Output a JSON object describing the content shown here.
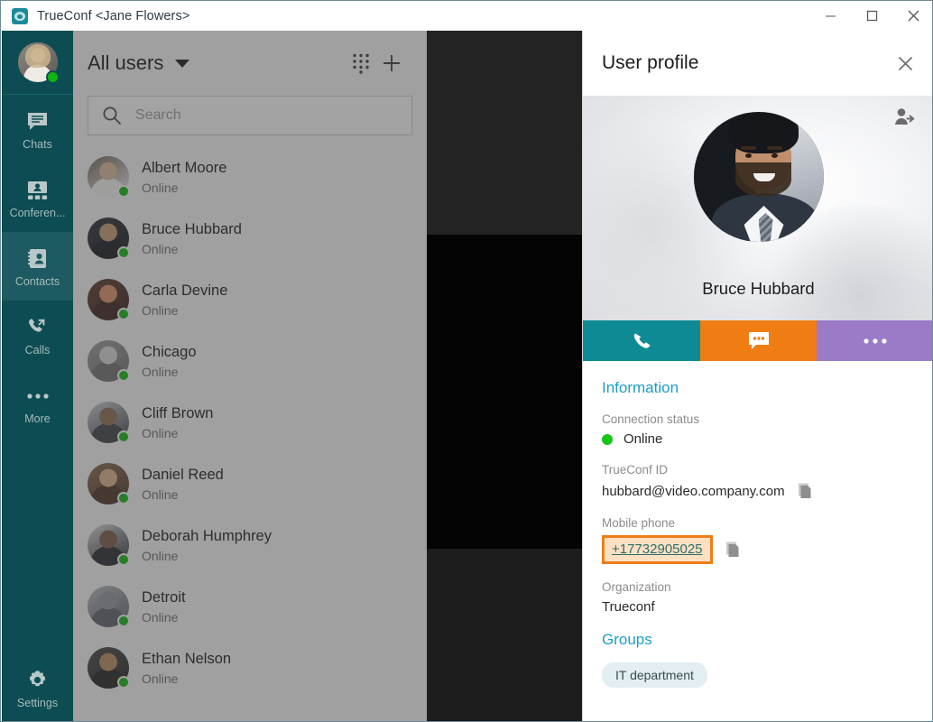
{
  "window": {
    "app_name": "TrueConf",
    "title": "TrueConf <Jane Flowers>",
    "logged_in_user": "<Jane Flowers>",
    "controls": {
      "minimize": "minimize-button",
      "maximize": "maximize-button",
      "close": "close-button"
    }
  },
  "rail": {
    "account_status": "Online",
    "items": [
      {
        "label": "Chats",
        "icon": "chat-bubble-icon",
        "active": false
      },
      {
        "label": "Conferen...",
        "icon": "conference-icon",
        "active": false
      },
      {
        "label": "Contacts",
        "icon": "address-book-icon",
        "active": true
      },
      {
        "label": "Calls",
        "icon": "call-arrows-icon",
        "active": false
      },
      {
        "label": "More",
        "icon": "ellipsis-icon",
        "active": false
      }
    ],
    "settings": {
      "label": "Settings",
      "icon": "gear-icon"
    }
  },
  "contacts": {
    "group_selector": "All users",
    "dialpad_icon": "dialpad-icon",
    "add_icon": "plus-icon",
    "search": {
      "placeholder": "Search",
      "value": "",
      "icon": "search-icon"
    },
    "list": [
      {
        "name": "Albert Moore",
        "status": "Online"
      },
      {
        "name": "Bruce Hubbard",
        "status": "Online"
      },
      {
        "name": "Carla Devine",
        "status": "Online"
      },
      {
        "name": "Chicago",
        "status": "Online"
      },
      {
        "name": "Cliff Brown",
        "status": "Online"
      },
      {
        "name": "Daniel Reed",
        "status": "Online"
      },
      {
        "name": "Deborah Humphrey",
        "status": "Online"
      },
      {
        "name": "Detroit",
        "status": "Online"
      },
      {
        "name": "Ethan Nelson",
        "status": "Online"
      }
    ]
  },
  "profile": {
    "panel_title": "User profile",
    "close_icon": "close-icon",
    "share_icon": "share-contact-icon",
    "display_name": "Bruce Hubbard",
    "actions": [
      {
        "name": "call",
        "icon": "phone-icon",
        "color": "#0d8a94"
      },
      {
        "name": "chat",
        "icon": "chat-bubble-icon",
        "color": "#f07d14"
      },
      {
        "name": "more",
        "icon": "ellipsis-icon",
        "color": "#9b7bc8"
      }
    ],
    "information": {
      "heading": "Information",
      "connection_status_label": "Connection status",
      "connection_status_value": "Online",
      "connection_status_color": "#16c516",
      "trueconf_id_label": "TrueConf ID",
      "trueconf_id_value": "hubbard@video.company.com",
      "trueconf_id_copy_icon": "copy-icon",
      "mobile_phone_label": "Mobile phone",
      "mobile_phone_value": "+17732905025",
      "mobile_phone_copy_icon": "copy-icon",
      "organization_label": "Organization",
      "organization_value": "Trueconf"
    },
    "groups": {
      "heading": "Groups",
      "items": [
        "IT department"
      ]
    },
    "highlight_color": "#ef7d18"
  }
}
